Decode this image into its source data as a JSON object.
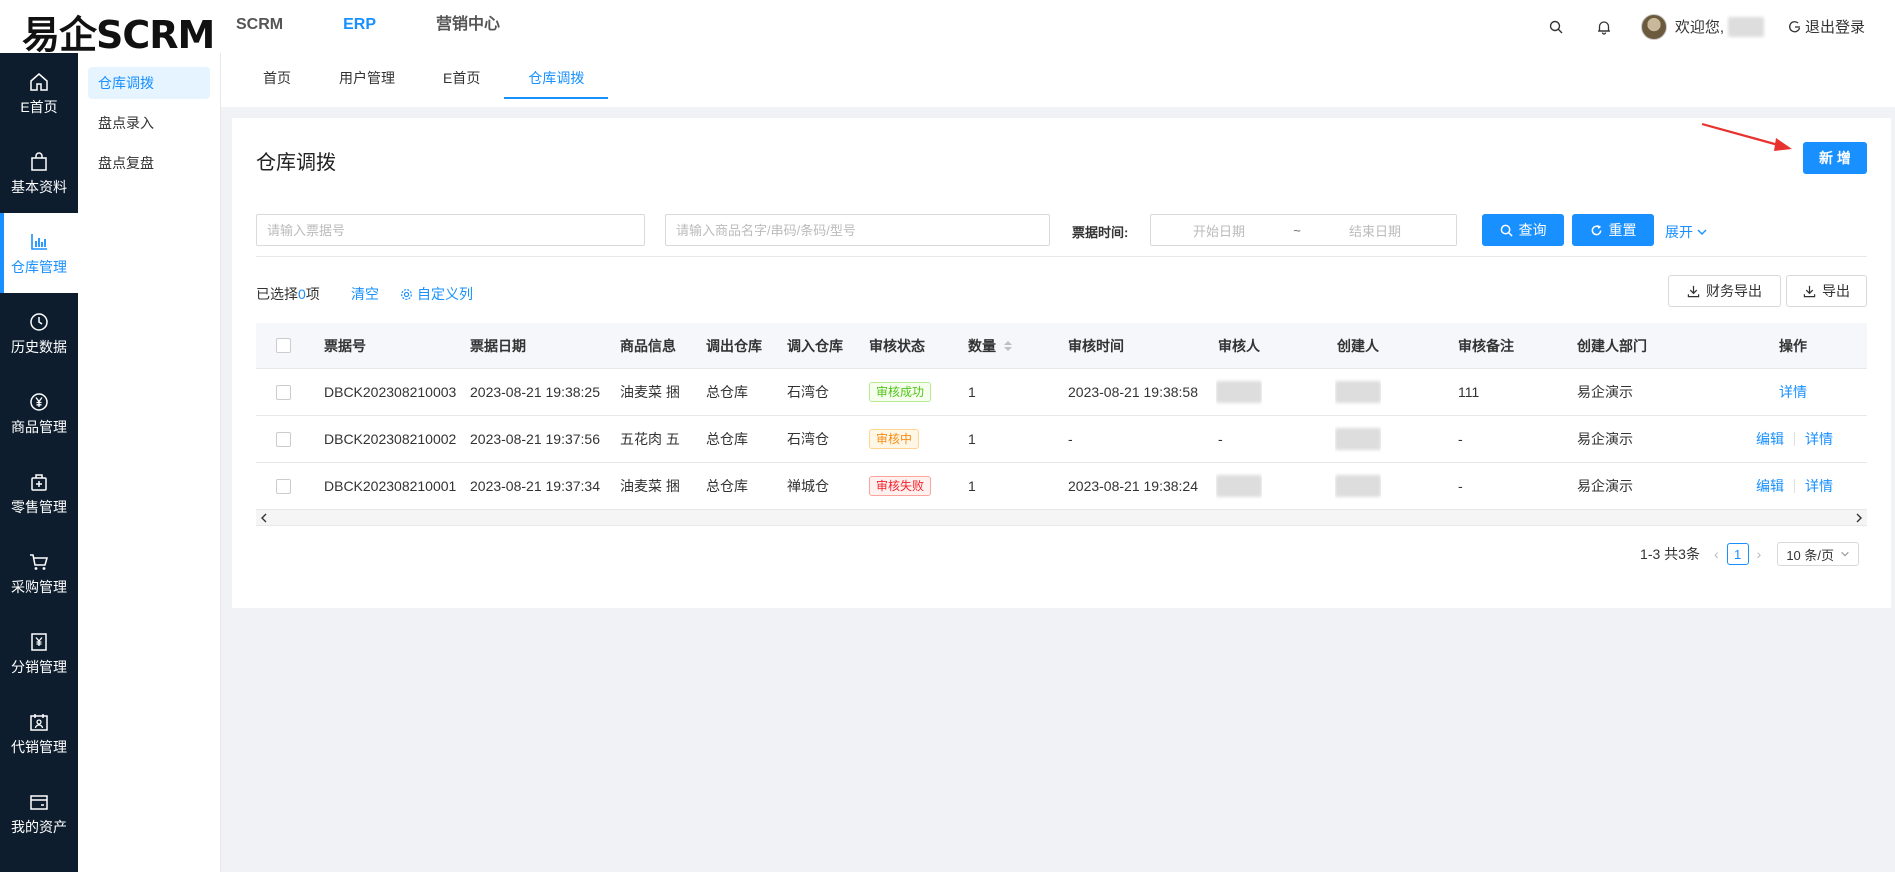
{
  "header": {
    "logo": "易企SCRM",
    "nav": [
      {
        "label": "SCRM",
        "active": false
      },
      {
        "label": "ERP",
        "active": true
      },
      {
        "label": "营销中心",
        "active": false
      }
    ],
    "welcome": "欢迎您,",
    "logout": "退出登录"
  },
  "sidebar": {
    "items": [
      {
        "label": "E首页",
        "icon": "home-icon"
      },
      {
        "label": "基本资料",
        "icon": "bag-icon"
      },
      {
        "label": "仓库管理",
        "icon": "chart-icon",
        "active": true
      },
      {
        "label": "历史数据",
        "icon": "clock-icon"
      },
      {
        "label": "商品管理",
        "icon": "yen-icon"
      },
      {
        "label": "零售管理",
        "icon": "box-icon"
      },
      {
        "label": "采购管理",
        "icon": "cart-icon"
      },
      {
        "label": "分销管理",
        "icon": "yen-doc-icon"
      },
      {
        "label": "代销管理",
        "icon": "calendar-user-icon"
      },
      {
        "label": "我的资产",
        "icon": "wallet-icon"
      }
    ]
  },
  "submenu": {
    "items": [
      {
        "label": "仓库调拨",
        "active": true
      },
      {
        "label": "盘点录入",
        "active": false
      },
      {
        "label": "盘点复盘",
        "active": false
      }
    ]
  },
  "tabs": [
    {
      "label": "首页",
      "active": false
    },
    {
      "label": "用户管理",
      "active": false
    },
    {
      "label": "E首页",
      "active": false
    },
    {
      "label": "仓库调拨",
      "active": true
    }
  ],
  "main": {
    "title": "仓库调拨",
    "add_button": "新 增",
    "search": {
      "ticket_placeholder": "请输入票据号",
      "product_placeholder": "请输入商品名字/串码/条码/型号",
      "date_label": "票据时间:",
      "start_placeholder": "开始日期",
      "range_sep": "~",
      "end_placeholder": "结束日期",
      "query_button": "查询",
      "reset_button": "重置",
      "expand": "展开"
    },
    "selection": {
      "prefix": "已选择",
      "count": "0",
      "suffix": "项",
      "clear": "清空",
      "custom_columns": "自定义列"
    },
    "export": {
      "finance": "财务导出",
      "export": "导出"
    },
    "table": {
      "columns": [
        "票据号",
        "票据日期",
        "商品信息",
        "调出仓库",
        "调入仓库",
        "审核状态",
        "数量",
        "审核时间",
        "审核人",
        "创建人",
        "审核备注",
        "创建人部门",
        "操作"
      ],
      "rows": [
        {
          "ticket": "DBCK202308210003",
          "date": "2023-08-21 19:38:25",
          "product": "油麦菜 捆",
          "out": "总仓库",
          "in": "石湾仓",
          "status": "审核成功",
          "status_type": "success",
          "qty": "1",
          "audit_time": "2023-08-21 19:38:58",
          "auditor_blur": true,
          "creator_blur": true,
          "note": "111",
          "dept": "易企演示",
          "ops": [
            "详情"
          ]
        },
        {
          "ticket": "DBCK202308210002",
          "date": "2023-08-21 19:37:56",
          "product": "五花肉 五",
          "out": "总仓库",
          "in": "石湾仓",
          "status": "审核中",
          "status_type": "pending",
          "qty": "1",
          "audit_time": "-",
          "auditor": "-",
          "auditor_blur": false,
          "creator_blur": true,
          "note": "-",
          "dept": "易企演示",
          "ops": [
            "编辑",
            "详情"
          ]
        },
        {
          "ticket": "DBCK202308210001",
          "date": "2023-08-21 19:37:34",
          "product": "油麦菜 捆",
          "out": "总仓库",
          "in": "禅城仓",
          "status": "审核失败",
          "status_type": "fail",
          "qty": "1",
          "audit_time": "2023-08-21 19:38:24",
          "auditor_blur": true,
          "creator_blur": true,
          "note": "-",
          "dept": "易企演示",
          "ops": [
            "编辑",
            "详情"
          ]
        }
      ]
    },
    "pagination": {
      "summary": "1-3 共3条",
      "current": "1",
      "page_size": "10 条/页"
    }
  },
  "colors": {
    "primary": "#1890ff",
    "sidebar_bg": "#0e1d2e",
    "arrow": "#e8322d"
  }
}
